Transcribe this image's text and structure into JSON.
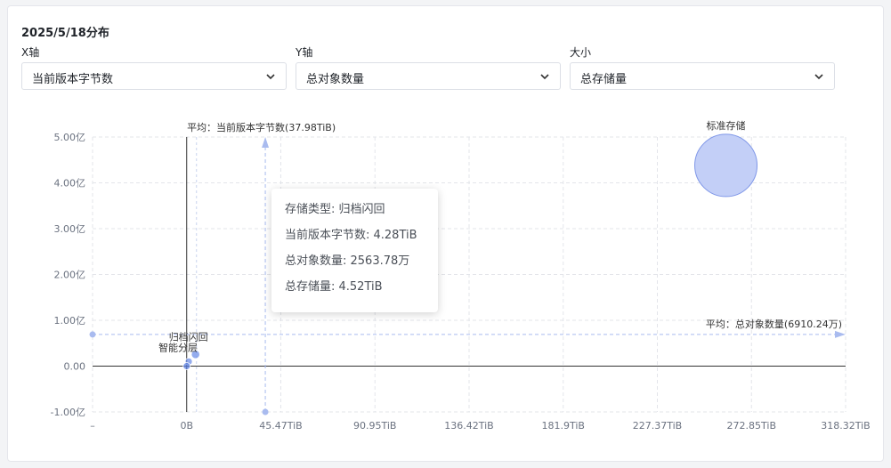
{
  "panel": {
    "title": "2025/5/18分布",
    "controls": [
      {
        "label": "X轴",
        "value": "当前版本字节数"
      },
      {
        "label": "Y轴",
        "value": "总对象数量"
      },
      {
        "label": "大小",
        "value": "总存储量"
      }
    ]
  },
  "tooltip": {
    "rows": [
      "存储类型: 归档闪回",
      "当前版本字节数: 4.28TiB",
      "总对象数量: 2563.78万",
      "总存储量: 4.52TiB"
    ]
  },
  "chart_data": {
    "type": "scatter",
    "variant": "bubble",
    "x_unit": "TiB",
    "y_unit": "亿",
    "xlim": [
      -45.47,
      318.32
    ],
    "ylim": [
      -1.0,
      5.0
    ],
    "x_ticks": [
      "–",
      "0B",
      "45.47TiB",
      "90.95TiB",
      "136.42TiB",
      "181.9TiB",
      "227.37TiB",
      "272.85TiB",
      "318.32TiB"
    ],
    "y_ticks": [
      "-1.00亿",
      "0.00",
      "1.00亿",
      "2.00亿",
      "3.00亿",
      "4.00亿",
      "5.00亿"
    ],
    "x_tick_values": [
      -45.47,
      0,
      45.47,
      90.95,
      136.42,
      181.9,
      227.37,
      272.85,
      318.32
    ],
    "y_tick_values": [
      -1,
      0,
      1,
      2,
      3,
      4,
      5
    ],
    "grid": true,
    "colors": {
      "bubble_fill": "#c3cff7",
      "bubble_stroke": "#7f97e8",
      "point": "#7090e8",
      "avg_line": "#a9bbef",
      "axis": "#333333",
      "grid": "#e3e5ea"
    },
    "points": [
      {
        "label": "标准存储",
        "x": 260.5,
        "y": 4.38,
        "size": 250.0
      },
      {
        "label": "归档闪回",
        "x": 4.28,
        "y": 0.256,
        "size": 4.52
      },
      {
        "label": "智能分层",
        "x": 1.0,
        "y": 0.1,
        "size": 1.0
      },
      {
        "label": "",
        "x": 0.0,
        "y": 0.0,
        "size": 0.2
      }
    ],
    "averages": {
      "x": {
        "value": 37.98,
        "label": "平均：当前版本字节数(37.98TiB)"
      },
      "y": {
        "value": 0.691,
        "label": "平均：总对象数量(6910.24万)"
      }
    }
  }
}
